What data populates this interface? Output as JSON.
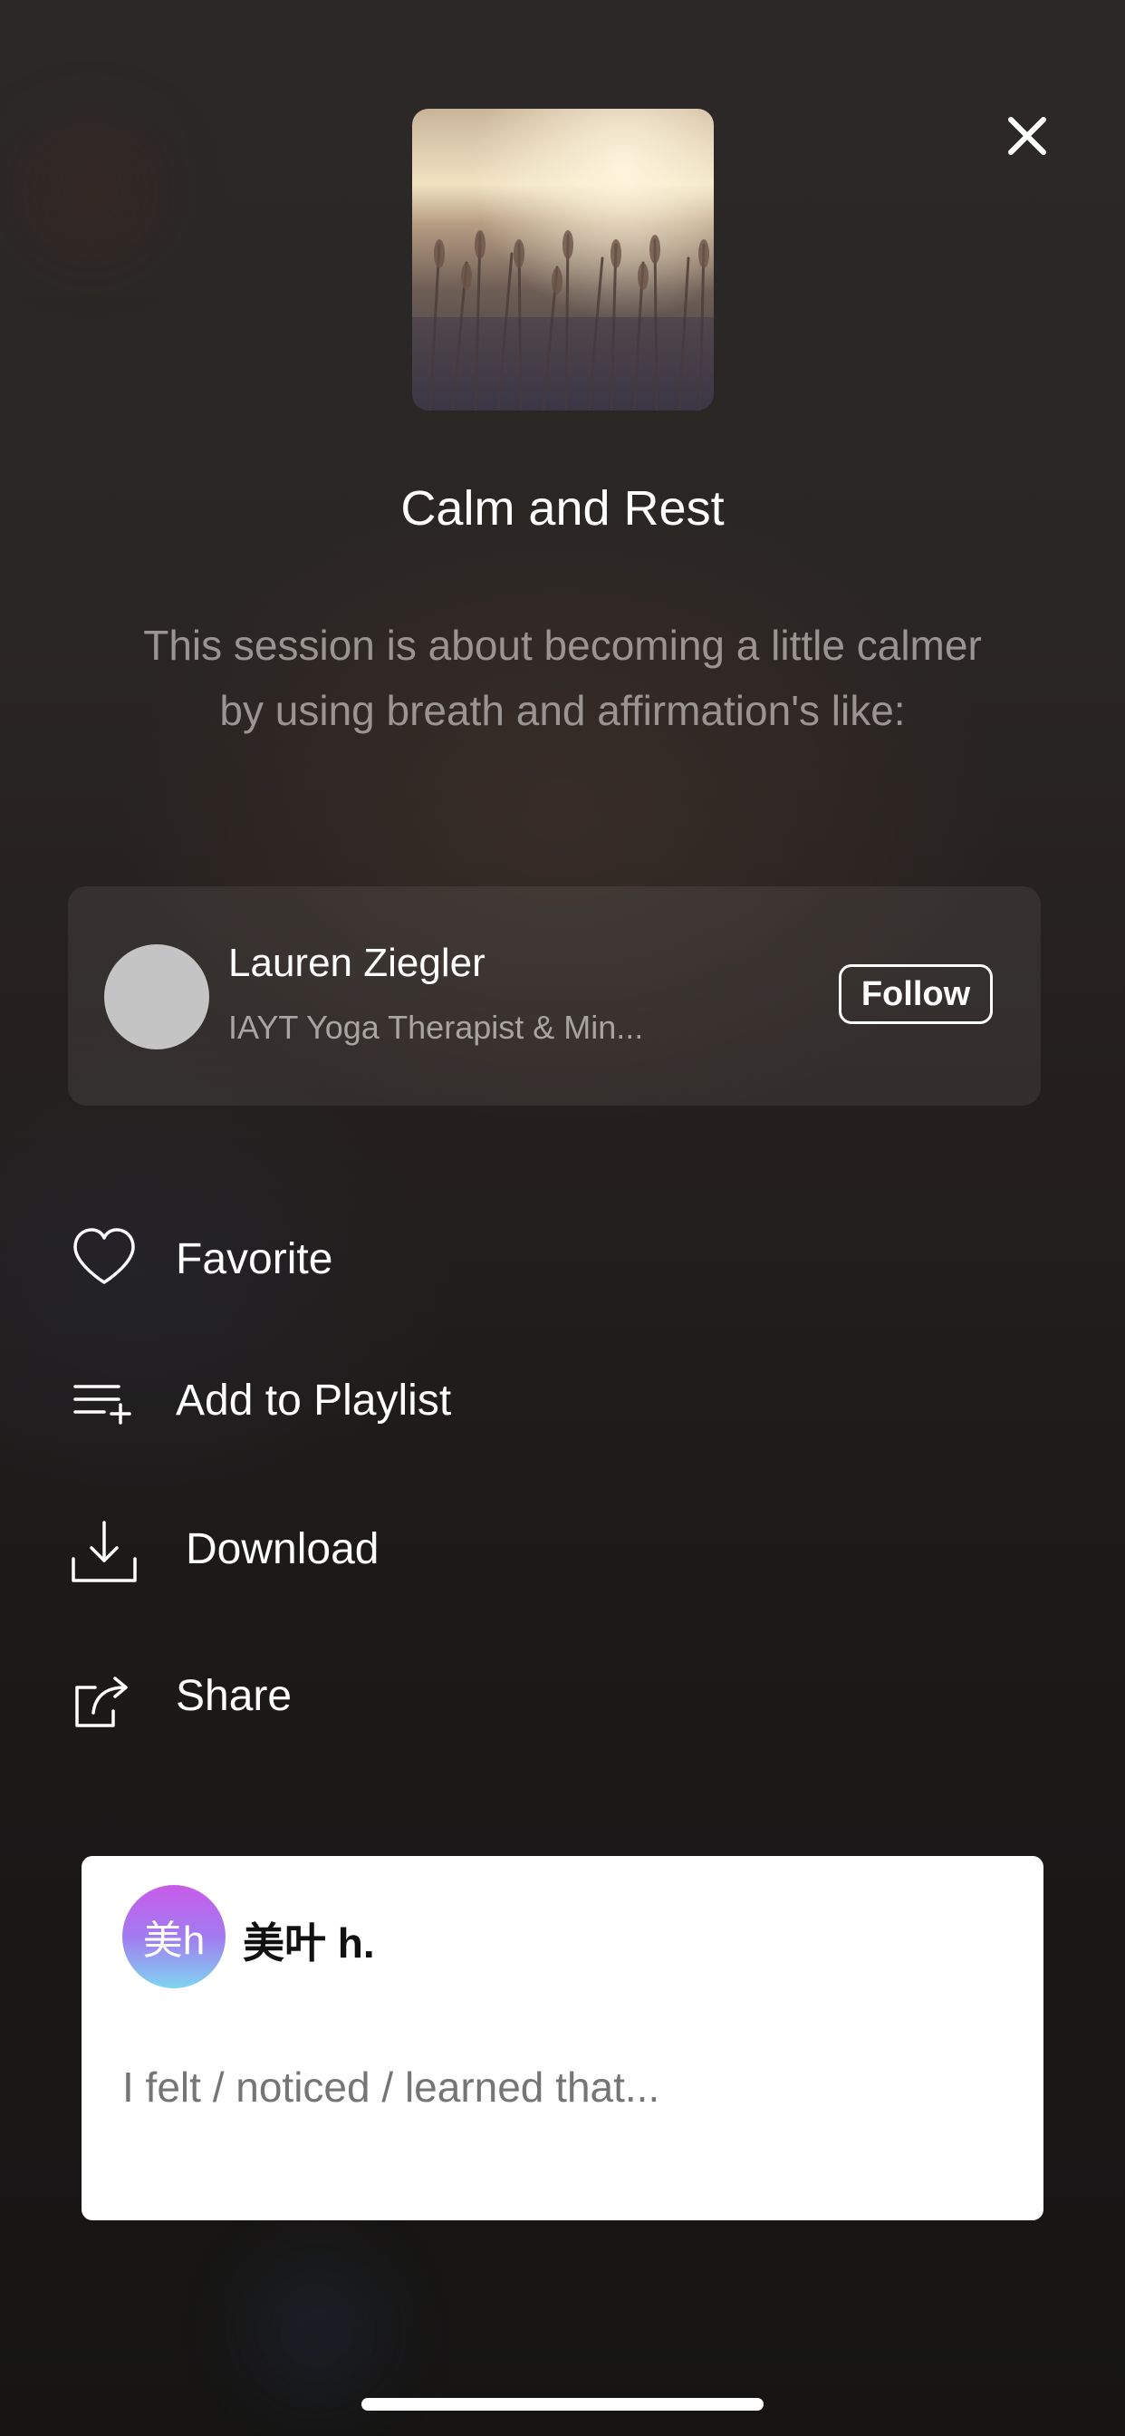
{
  "session": {
    "title": "Calm and Rest",
    "description": "This session is about becoming a little calmer by using breath and affirmation's like:",
    "artwork_icon": "wheat-field-photo"
  },
  "author": {
    "name": "Lauren Ziegler",
    "subtitle": "IAYT Yoga Therapist & Min...",
    "follow_label": "Follow"
  },
  "actions": [
    {
      "label": "Favorite",
      "icon": "heart-icon"
    },
    {
      "label": "Add to Playlist",
      "icon": "playlist-add-icon"
    },
    {
      "label": "Download",
      "icon": "download-icon"
    },
    {
      "label": "Share",
      "icon": "share-icon"
    }
  ],
  "reflection": {
    "user_initials": "美h",
    "user_name": "美叶 h.",
    "placeholder": "I felt / noticed / learned that..."
  },
  "colors": {
    "background": "#1c1a19",
    "card": "#ffffff",
    "text_primary": "#ffffff",
    "text_secondary": "#9a9593"
  }
}
